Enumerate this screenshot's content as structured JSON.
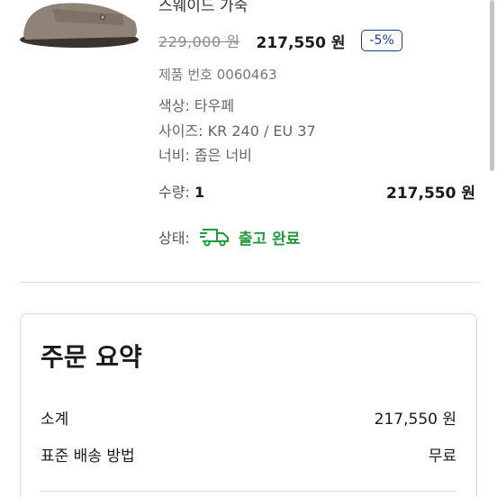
{
  "product": {
    "title": "스웨이드 가죽",
    "original_price": "229,000 원",
    "current_price": "217,550 원",
    "discount": "-5%",
    "product_number": "제품 번호 0060463",
    "color": "색상: 타우페",
    "size": "사이즈: KR 240 / EU 37",
    "width": "너비: 좁은 너비",
    "quantity_label": "수량:",
    "quantity_value": "1",
    "line_total": "217,550 원",
    "status_label": "상태:",
    "status_text": "출고 완료"
  },
  "summary": {
    "title": "주문 요약",
    "subtotal_label": "소계",
    "subtotal_value": "217,550 원",
    "shipping_label": "표준 배송 방법",
    "shipping_value": "무료"
  },
  "colors": {
    "status_green": "#1f9c3a",
    "badge_blue": "#1d3a8f"
  },
  "icons": {
    "status": "truck-icon"
  }
}
